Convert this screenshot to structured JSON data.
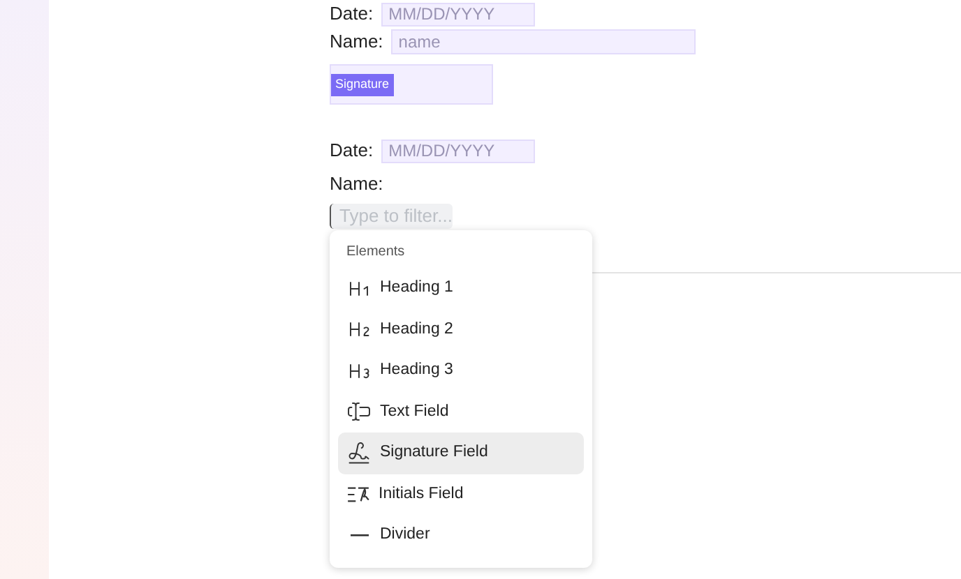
{
  "form_top": {
    "date_label": "Date:",
    "date_placeholder": "MM/DD/YYYY",
    "name_label": "Name:",
    "name_placeholder": "name",
    "signature_badge": "Signature"
  },
  "form_bottom": {
    "date_label": "Date:",
    "date_placeholder": "MM/DD/YYYY",
    "name_label": "Name:",
    "filter_placeholder": "Type to filter..."
  },
  "menu": {
    "heading": "Elements",
    "items": [
      {
        "kind": "heading1",
        "label": "Heading 1",
        "selected": false
      },
      {
        "kind": "heading2",
        "label": "Heading 2",
        "selected": false
      },
      {
        "kind": "heading3",
        "label": "Heading 3",
        "selected": false
      },
      {
        "kind": "textfield",
        "label": "Text Field",
        "selected": false
      },
      {
        "kind": "signature",
        "label": "Signature Field",
        "selected": true
      },
      {
        "kind": "initials",
        "label": "Initials Field",
        "selected": false
      },
      {
        "kind": "divider",
        "label": "Divider",
        "selected": false
      }
    ]
  }
}
